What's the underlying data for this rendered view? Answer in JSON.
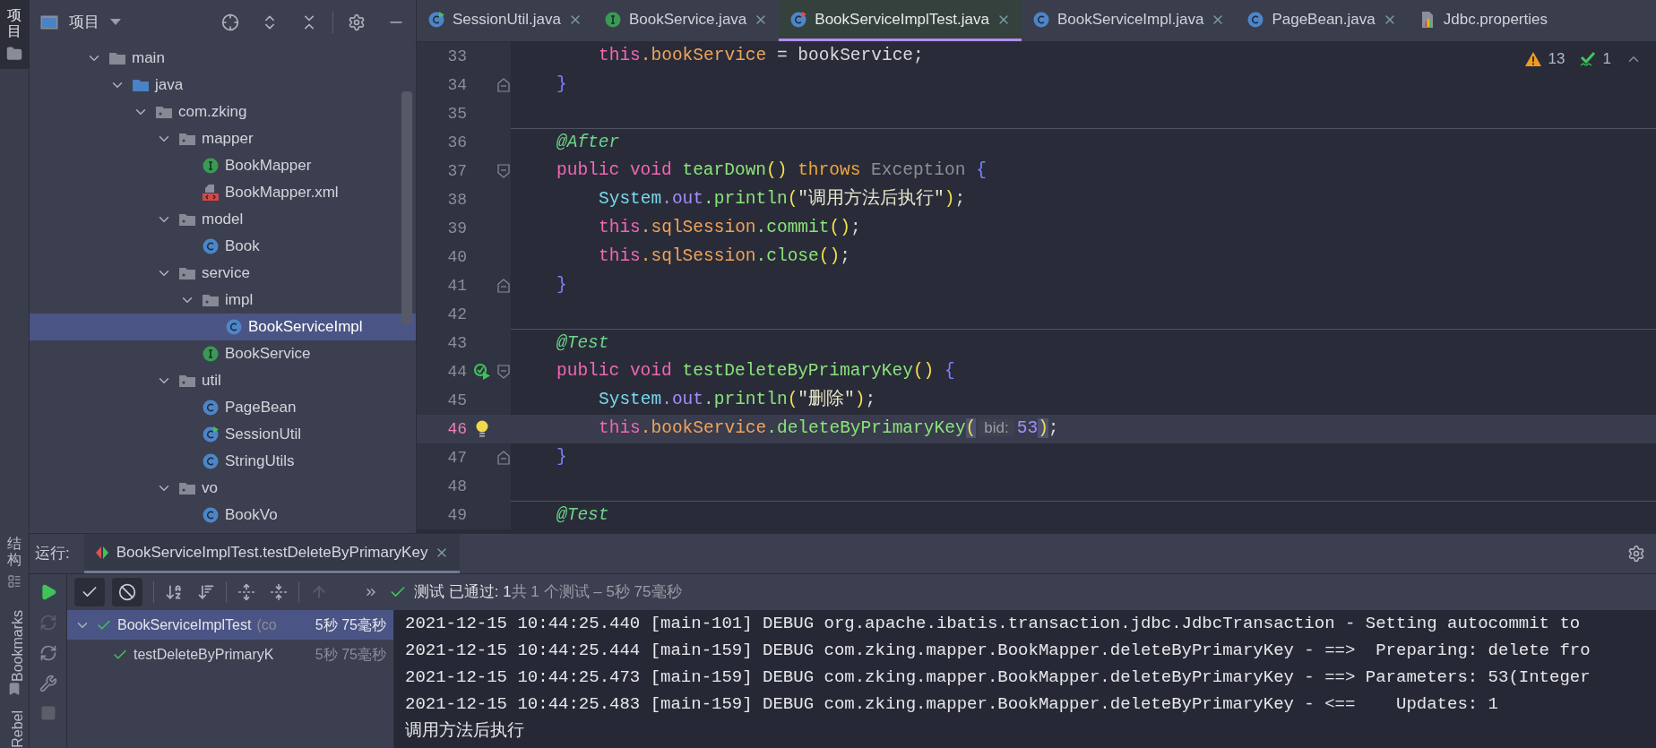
{
  "tool_strip": {
    "top": [
      {
        "label": "项目",
        "kind": "cjk",
        "selected": true
      }
    ],
    "bottom": [
      {
        "label": "结构",
        "kind": "cjk",
        "selected": false
      },
      {
        "label": "Bookmarks",
        "kind": "latin",
        "selected": false
      },
      {
        "label": "Rebel",
        "kind": "latin",
        "selected": false
      }
    ]
  },
  "project_panel": {
    "title": "项目",
    "tree": [
      {
        "name": "main",
        "kind": "folder",
        "expanded": true,
        "selected": false,
        "children": [
          {
            "name": "java",
            "kind": "source-folder",
            "expanded": true,
            "selected": false,
            "children": [
              {
                "name": "com.zking",
                "kind": "package",
                "expanded": true,
                "selected": false,
                "children": [
                  {
                    "name": "mapper",
                    "kind": "package",
                    "expanded": true,
                    "selected": false,
                    "children": [
                      {
                        "name": "BookMapper",
                        "kind": "interface",
                        "selected": false
                      },
                      {
                        "name": "BookMapper.xml",
                        "kind": "xml",
                        "selected": false
                      }
                    ]
                  },
                  {
                    "name": "model",
                    "kind": "package",
                    "expanded": true,
                    "selected": false,
                    "children": [
                      {
                        "name": "Book",
                        "kind": "class",
                        "selected": false
                      }
                    ]
                  },
                  {
                    "name": "service",
                    "kind": "package",
                    "expanded": true,
                    "selected": false,
                    "children": [
                      {
                        "name": "impl",
                        "kind": "package",
                        "expanded": true,
                        "selected": false,
                        "children": [
                          {
                            "name": "BookServiceImpl",
                            "kind": "class",
                            "selected": true
                          }
                        ]
                      },
                      {
                        "name": "BookService",
                        "kind": "interface",
                        "selected": false
                      }
                    ]
                  },
                  {
                    "name": "util",
                    "kind": "package",
                    "expanded": true,
                    "selected": false,
                    "children": [
                      {
                        "name": "PageBean",
                        "kind": "class",
                        "selected": false
                      },
                      {
                        "name": "SessionUtil",
                        "kind": "runnable-class",
                        "selected": false
                      },
                      {
                        "name": "StringUtils",
                        "kind": "class",
                        "selected": false
                      }
                    ]
                  },
                  {
                    "name": "vo",
                    "kind": "package",
                    "expanded": true,
                    "selected": false,
                    "children": [
                      {
                        "name": "BookVo",
                        "kind": "class",
                        "selected": false
                      }
                    ]
                  }
                ]
              }
            ]
          }
        ]
      }
    ]
  },
  "editor": {
    "tabs": [
      {
        "label": "SessionUtil.java",
        "kind": "runnable-class",
        "selected": false,
        "closable": true
      },
      {
        "label": "BookService.java",
        "kind": "interface",
        "selected": false,
        "closable": true
      },
      {
        "label": "BookServiceImplTest.java",
        "kind": "test-class",
        "selected": true,
        "closable": true
      },
      {
        "label": "BookServiceImpl.java",
        "kind": "class",
        "selected": false,
        "closable": true
      },
      {
        "label": "PageBean.java",
        "kind": "class",
        "selected": false,
        "closable": true
      },
      {
        "label": "Jdbc.properties",
        "kind": "properties",
        "selected": false,
        "closable": false
      }
    ],
    "inspections": {
      "warnings": "13",
      "passed": "1"
    },
    "lines": [
      {
        "number": "33",
        "kind": "statement",
        "current": false,
        "separator": false,
        "tokens": [
          {
            "text": "this",
            "kind": "keyword"
          },
          {
            "text": ".bookService",
            "kind": "field"
          },
          {
            "text": " = bookService;",
            "kind": "plain"
          }
        ]
      },
      {
        "number": "34",
        "kind": "member",
        "current": false,
        "separator": false,
        "fold": {
          "kind": "end"
        },
        "tokens": [
          {
            "text": "}",
            "kind": "brace"
          }
        ]
      },
      {
        "number": "35",
        "kind": "blank",
        "current": false,
        "separator": false
      },
      {
        "number": "36",
        "kind": "member",
        "current": false,
        "separator": true,
        "tokens": [
          {
            "text": "@After",
            "kind": "annotation"
          }
        ]
      },
      {
        "number": "37",
        "kind": "member",
        "current": false,
        "separator": false,
        "fold": {
          "kind": "start"
        },
        "tokens": [
          {
            "text": "public void ",
            "kind": "keyword"
          },
          {
            "text": "tearDown",
            "kind": "method"
          },
          {
            "text": "() ",
            "kind": "paren"
          },
          {
            "text": "throws ",
            "kind": "keyword2"
          },
          {
            "text": "Exception ",
            "kind": "muted"
          },
          {
            "text": "{",
            "kind": "brace"
          }
        ]
      },
      {
        "number": "38",
        "kind": "statement",
        "current": false,
        "separator": false,
        "tokens": [
          {
            "text": "System",
            "kind": "class"
          },
          {
            "text": ".out",
            "kind": "static-field"
          },
          {
            "text": ".println",
            "kind": "method"
          },
          {
            "text": "(",
            "kind": "paren"
          },
          {
            "text": "\"调用方法后执行\"",
            "kind": "string"
          },
          {
            "text": ")",
            "kind": "paren"
          },
          {
            "text": ";",
            "kind": "plain"
          }
        ]
      },
      {
        "number": "39",
        "kind": "statement",
        "current": false,
        "separator": false,
        "tokens": [
          {
            "text": "this",
            "kind": "keyword"
          },
          {
            "text": ".sqlSession",
            "kind": "field"
          },
          {
            "text": ".commit",
            "kind": "method"
          },
          {
            "text": "()",
            "kind": "paren"
          },
          {
            "text": ";",
            "kind": "plain"
          }
        ]
      },
      {
        "number": "40",
        "kind": "statement",
        "current": false,
        "separator": false,
        "tokens": [
          {
            "text": "this",
            "kind": "keyword"
          },
          {
            "text": ".sqlSession",
            "kind": "field"
          },
          {
            "text": ".close",
            "kind": "method"
          },
          {
            "text": "()",
            "kind": "paren"
          },
          {
            "text": ";",
            "kind": "plain"
          }
        ]
      },
      {
        "number": "41",
        "kind": "member",
        "current": false,
        "separator": false,
        "fold": {
          "kind": "end"
        },
        "tokens": [
          {
            "text": "}",
            "kind": "brace"
          }
        ]
      },
      {
        "number": "42",
        "kind": "blank",
        "current": false,
        "separator": false
      },
      {
        "number": "43",
        "kind": "member",
        "current": false,
        "separator": true,
        "tokens": [
          {
            "text": "@Test",
            "kind": "annotation"
          }
        ]
      },
      {
        "number": "44",
        "kind": "member",
        "current": false,
        "separator": false,
        "fold": {
          "kind": "start"
        },
        "gutter_icon": {
          "kind": "run"
        },
        "tokens": [
          {
            "text": "public void ",
            "kind": "keyword"
          },
          {
            "text": "testDeleteByPrimaryKey",
            "kind": "method"
          },
          {
            "text": "() ",
            "kind": "paren"
          },
          {
            "text": "{",
            "kind": "brace"
          }
        ]
      },
      {
        "number": "45",
        "kind": "statement",
        "current": false,
        "separator": false,
        "tokens": [
          {
            "text": "System",
            "kind": "class"
          },
          {
            "text": ".out",
            "kind": "static-field"
          },
          {
            "text": ".println",
            "kind": "method"
          },
          {
            "text": "(",
            "kind": "paren"
          },
          {
            "text": "\"删除\"",
            "kind": "string"
          },
          {
            "text": ")",
            "kind": "paren"
          },
          {
            "text": ";",
            "kind": "plain"
          }
        ]
      },
      {
        "number": "46",
        "kind": "statement",
        "current": true,
        "separator": false,
        "gutter_icon": {
          "kind": "bulb"
        },
        "tokens": [
          {
            "text": "this",
            "kind": "keyword"
          },
          {
            "text": ".bookService",
            "kind": "field"
          },
          {
            "text": ".deleteByPrimaryKey",
            "kind": "method"
          },
          {
            "text": "(",
            "kind": "matched-paren"
          },
          {
            "text": "bid:",
            "kind": "hint"
          },
          {
            "text": "53",
            "kind": "number"
          },
          {
            "text": ")",
            "kind": "matched-paren"
          },
          {
            "text": ";",
            "kind": "plain"
          }
        ]
      },
      {
        "number": "47",
        "kind": "member",
        "current": false,
        "separator": false,
        "fold": {
          "kind": "end"
        },
        "tokens": [
          {
            "text": "}",
            "kind": "brace"
          }
        ]
      },
      {
        "number": "48",
        "kind": "blank",
        "current": false,
        "separator": false
      },
      {
        "number": "49",
        "kind": "member",
        "current": false,
        "separator": true,
        "tokens": [
          {
            "text": "@Test",
            "kind": "annotation"
          }
        ]
      }
    ]
  },
  "run_panel": {
    "label": "运行:",
    "tab": {
      "title": "BookServiceImplTest.testDeleteByPrimaryKey",
      "closable": true
    },
    "toolbar": {
      "toggles": [
        {
          "kind": "show-passed",
          "selected": true
        },
        {
          "kind": "show-ignored",
          "selected": true
        }
      ],
      "status_main": "测试 已通过: 1",
      "status_detail": "共 1 个测试 – 5秒 75毫秒"
    },
    "tests": [
      {
        "name": "BookServiceImplTest",
        "note": "(co",
        "time": "5秒 75毫秒",
        "selected": true,
        "expanded": true,
        "children": [
          {
            "name": "testDeleteByPrimaryK",
            "time": "5秒 75毫秒",
            "selected": false
          }
        ]
      }
    ],
    "console": [
      "2021-12-15 10:44:25.440 [main-101] DEBUG org.apache.ibatis.transaction.jdbc.JdbcTransaction - Setting autocommit to",
      "2021-12-15 10:44:25.444 [main-159] DEBUG com.zking.mapper.BookMapper.deleteByPrimaryKey - ==>  Preparing: delete fro",
      "2021-12-15 10:44:25.473 [main-159] DEBUG com.zking.mapper.BookMapper.deleteByPrimaryKey - ==> Parameters: 53(Integer",
      "2021-12-15 10:44:25.483 [main-159] DEBUG com.zking.mapper.BookMapper.deleteByPrimaryKey - <==    Updates: 1",
      "调用方法后执行"
    ]
  }
}
